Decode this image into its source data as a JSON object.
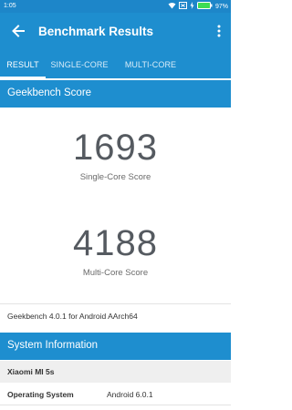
{
  "status_bar": {
    "time": "1:05",
    "battery": "97%",
    "icons": [
      "wifi-icon",
      "sim-icon",
      "charging-icon",
      "battery-icon"
    ]
  },
  "app_bar": {
    "title": "Benchmark Results",
    "back_icon": "arrow-left-icon",
    "more_icon": "more-vert-icon"
  },
  "tabs": [
    {
      "label": "RESULT",
      "selected": true
    },
    {
      "label": "SINGLE-CORE",
      "selected": false
    },
    {
      "label": "MULTI-CORE",
      "selected": false
    }
  ],
  "geekbench_score": {
    "header": "Geekbench Score",
    "single_core": {
      "value": "1693",
      "label": "Single-Core Score"
    },
    "multi_core": {
      "value": "4188",
      "label": "Multi-Core Score"
    }
  },
  "version_text": "Geekbench 4.0.1 for Android AArch64",
  "system_information": {
    "header": "System Information",
    "device": "Xiaomi MI 5s",
    "rows": [
      {
        "key": "Operating System",
        "value": "Android 6.0.1"
      }
    ]
  },
  "colors": {
    "primary": "#1e8ecf",
    "status_bar": "#1d86c9",
    "score_text": "#555a60",
    "row_shade": "#efefef"
  }
}
